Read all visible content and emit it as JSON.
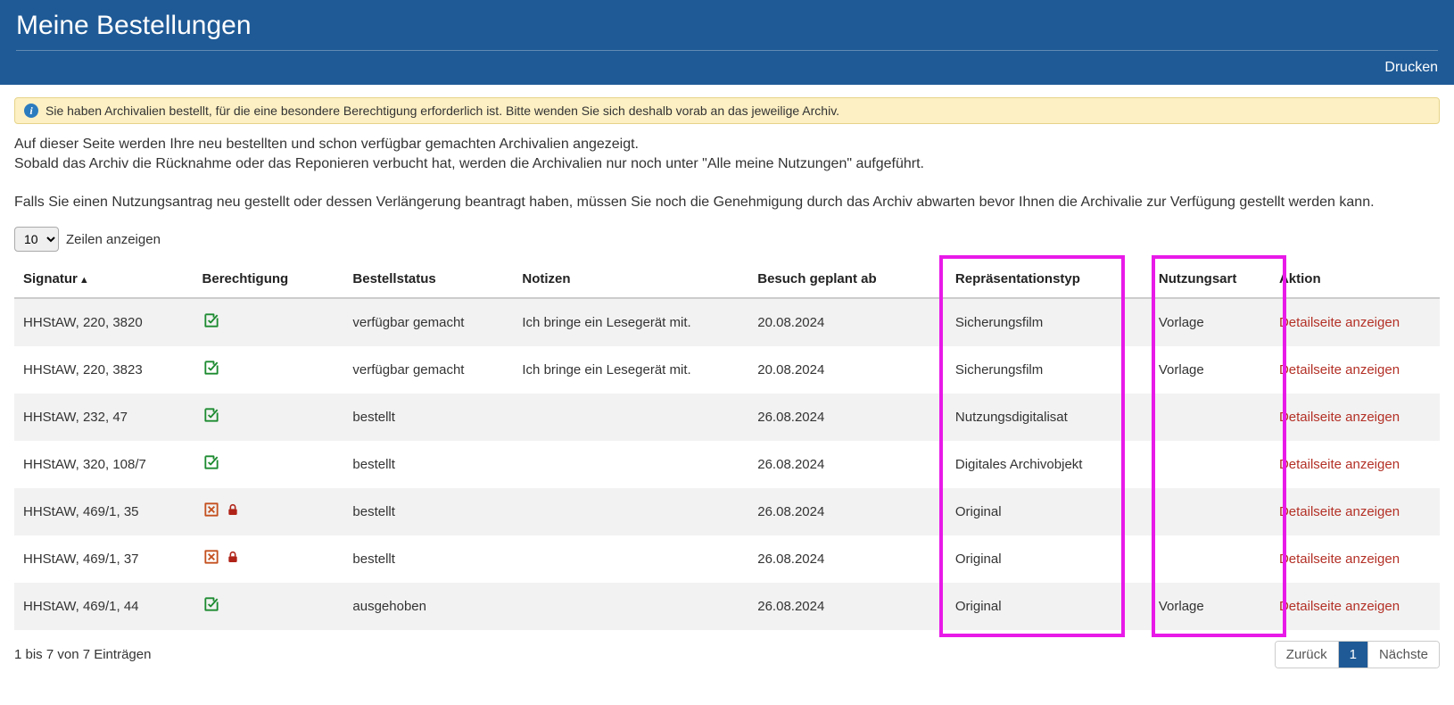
{
  "header": {
    "title": "Meine Bestellungen",
    "print": "Drucken"
  },
  "alert": {
    "text": "Sie haben Archivalien bestellt, für die eine besondere Berechtigung erforderlich ist. Bitte wenden Sie sich deshalb vorab an das jeweilige Archiv."
  },
  "intro": {
    "p1": "Auf dieser Seite werden Ihre neu bestellten und schon verfügbar gemachten Archivalien angezeigt.",
    "p2": "Sobald das Archiv die Rücknahme oder das Reponieren verbucht hat, werden die Archivalien nur noch unter \"Alle meine Nutzungen\" aufgeführt.",
    "p3": "Falls Sie einen Nutzungsantrag neu gestellt oder dessen Verlängerung beantragt haben, müssen Sie noch die Genehmigung durch das Archiv abwarten bevor Ihnen die Archivalie zur Verfügung gestellt werden kann."
  },
  "rows_control": {
    "value": "10",
    "label": "Zeilen anzeigen"
  },
  "columns": {
    "signatur": "Signatur",
    "berechtigung": "Berechtigung",
    "bestellstatus": "Bestellstatus",
    "notizen": "Notizen",
    "besuch": "Besuch geplant ab",
    "reptyp": "Repräsentationstyp",
    "nutzungsart": "Nutzungsart",
    "aktion": "Aktion"
  },
  "action_label": "Detailseite anzeigen",
  "rows": [
    {
      "sig": "HHStAW, 220, 3820",
      "perm": "granted",
      "status": "verfügbar gemacht",
      "note": "Ich bringe ein Lesegerät mit.",
      "date": "20.08.2024",
      "rep": "Sicherungsfilm",
      "use": "Vorlage"
    },
    {
      "sig": "HHStAW, 220, 3823",
      "perm": "granted",
      "status": "verfügbar gemacht",
      "note": "Ich bringe ein Lesegerät mit.",
      "date": "20.08.2024",
      "rep": "Sicherungsfilm",
      "use": "Vorlage"
    },
    {
      "sig": "HHStAW, 232, 47",
      "perm": "granted",
      "status": "bestellt",
      "note": "",
      "date": "26.08.2024",
      "rep": "Nutzungsdigitalisat",
      "use": ""
    },
    {
      "sig": "HHStAW, 320, 108/7",
      "perm": "granted",
      "status": "bestellt",
      "note": "",
      "date": "26.08.2024",
      "rep": "Digitales Archivobjekt",
      "use": ""
    },
    {
      "sig": "HHStAW, 469/1, 35",
      "perm": "locked",
      "status": "bestellt",
      "note": "",
      "date": "26.08.2024",
      "rep": "Original",
      "use": ""
    },
    {
      "sig": "HHStAW, 469/1, 37",
      "perm": "locked",
      "status": "bestellt",
      "note": "",
      "date": "26.08.2024",
      "rep": "Original",
      "use": ""
    },
    {
      "sig": "HHStAW, 469/1, 44",
      "perm": "granted",
      "status": "ausgehoben",
      "note": "",
      "date": "26.08.2024",
      "rep": "Original",
      "use": "Vorlage"
    }
  ],
  "footer": {
    "count_text": "1 bis 7 von 7 Einträgen",
    "prev": "Zurück",
    "page": "1",
    "next": "Nächste"
  }
}
